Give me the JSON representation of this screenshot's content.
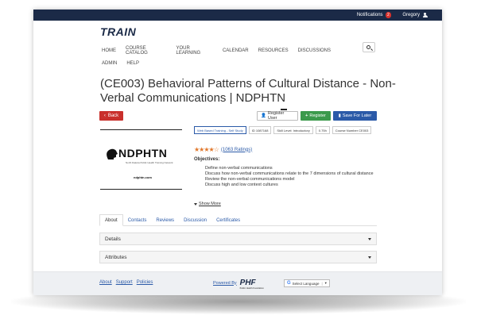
{
  "topbar": {
    "notifications_label": "Notifications",
    "notifications_count": "2",
    "user_name": "Gregory"
  },
  "header": {
    "logo": "TRAIN"
  },
  "nav": {
    "row1": [
      "HOME",
      "COURSE CATALOG",
      "YOUR LEARNING",
      "CALENDAR",
      "RESOURCES",
      "DISCUSSIONS"
    ],
    "row2": [
      "ADMIN",
      "HELP"
    ]
  },
  "course": {
    "title": "(CE003) Behavioral Patterns of Cultural Distance - Non-Verbal Communications | NDPHTN",
    "back_label": "Back",
    "register_user_label": "Register User",
    "register_label": "Register",
    "save_later_label": "Save For Later",
    "image": {
      "name": "NDPHTN",
      "subtitle": "North Dakota Public Health Training Network",
      "url": "ndphtn.com"
    },
    "tags": [
      "Web Based Training - Self Study",
      "ID 1087168",
      "Skill Level: Introductory",
      "0.75h",
      "Course Number CE003"
    ],
    "rating": {
      "stars": "★★★★☆",
      "count": "(1063 Ratings)"
    },
    "objectives_title": "Objectives:",
    "objectives": [
      "Define non-verbal communications",
      "Discuss how non-verbal communications relate to the 7 dimensions of cultural distance",
      "Review the non-verbal communications model",
      "Discuss high and low context cultures"
    ],
    "show_more": "Show More"
  },
  "tabs": [
    "About",
    "Contacts",
    "Reviews",
    "Discussion",
    "Certificates"
  ],
  "accordions": {
    "details": "Details",
    "attributes": "Attributes"
  },
  "footer": {
    "links": [
      "About",
      "Support",
      "Policies"
    ],
    "powered_by": "Powered By",
    "phf_logo": "PHF",
    "phf_sub": "Public Health Foundation",
    "lang_label": "Select Language",
    "lang_sep": "|"
  },
  "colors": {
    "navy": "#1b2a47",
    "back_red": "#c9302c",
    "register_green": "#3c9a4c",
    "save_blue": "#2b5aa8",
    "star_orange": "#e0772b"
  },
  "icons": [
    "user-icon",
    "search-icon",
    "chevron-left-icon",
    "user-plus-icon",
    "plus-icon",
    "bookmark-icon",
    "caret-down-icon",
    "google-icon"
  ]
}
